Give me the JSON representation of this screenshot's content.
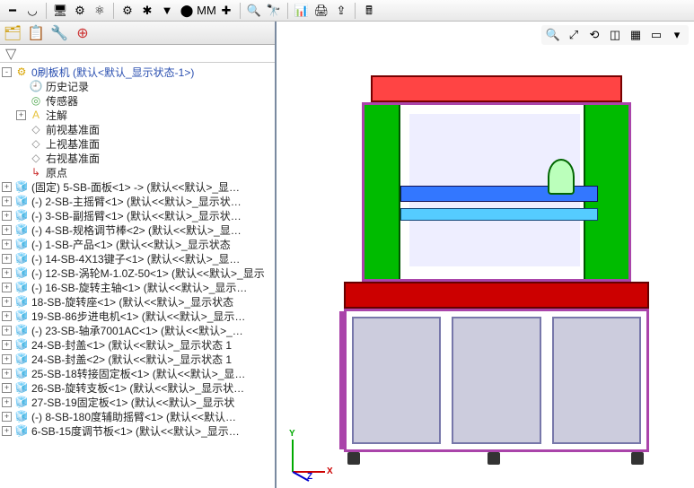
{
  "toolbar": {
    "buttons": [
      {
        "name": "line-icon",
        "glyph": "━",
        "sep": false
      },
      {
        "name": "arc-icon",
        "glyph": "◡",
        "sep": false
      },
      {
        "name": "sep",
        "glyph": "",
        "sep": true
      },
      {
        "name": "display-icon",
        "glyph": "🖥",
        "sep": false
      },
      {
        "name": "gear-icon",
        "glyph": "⚙",
        "sep": false
      },
      {
        "name": "option-icon",
        "glyph": "⚛",
        "sep": false
      },
      {
        "name": "sep",
        "glyph": "",
        "sep": true
      },
      {
        "name": "settings1-icon",
        "glyph": "⚙",
        "sep": false
      },
      {
        "name": "settings2-icon",
        "glyph": "✱",
        "sep": false
      },
      {
        "name": "toggle-icon",
        "glyph": "▼",
        "sep": false
      },
      {
        "name": "record-icon",
        "glyph": "⬤",
        "sep": false
      },
      {
        "name": "measure-icon",
        "glyph": "MM",
        "sep": false
      },
      {
        "name": "plus-icon",
        "glyph": "✚",
        "sep": false
      },
      {
        "name": "sep",
        "glyph": "",
        "sep": true
      },
      {
        "name": "search-icon",
        "glyph": "🔍",
        "sep": false
      },
      {
        "name": "binoculars-icon",
        "glyph": "🔭",
        "sep": false
      },
      {
        "name": "sep",
        "glyph": "",
        "sep": true
      },
      {
        "name": "excel-icon",
        "glyph": "📊",
        "sep": false
      },
      {
        "name": "print-icon",
        "glyph": "🖨",
        "sep": false
      },
      {
        "name": "export-icon",
        "glyph": "⇪",
        "sep": false
      },
      {
        "name": "sep",
        "glyph": "",
        "sep": true
      },
      {
        "name": "calc-icon",
        "glyph": "🖩",
        "sep": false
      }
    ]
  },
  "treeTabs": [
    {
      "name": "feature-manager-tab",
      "glyph": "🗂",
      "color": "#c90"
    },
    {
      "name": "property-manager-tab",
      "glyph": "📋",
      "color": "#7a4"
    },
    {
      "name": "config-manager-tab",
      "glyph": "🔧",
      "color": "#888"
    },
    {
      "name": "dimxpert-tab",
      "glyph": "⊕",
      "color": "#c33"
    }
  ],
  "filterGlyph": "▽",
  "tree": {
    "root": {
      "icon": "⚙",
      "iconCls": "ico-asm",
      "expandable": true,
      "exp": "-",
      "label": "0刷板机  (默认<默认_显示状态-1>)"
    },
    "children": [
      {
        "icon": "🕘",
        "iconCls": "ico-hist",
        "expandable": false,
        "label": "历史记录",
        "depth": 1
      },
      {
        "icon": "◎",
        "iconCls": "ico-sensor",
        "expandable": false,
        "label": "传感器",
        "depth": 1
      },
      {
        "icon": "A",
        "iconCls": "ico-note",
        "expandable": true,
        "exp": "+",
        "label": "注解",
        "depth": 1
      },
      {
        "icon": "◇",
        "iconCls": "ico-plane",
        "expandable": false,
        "label": "前视基准面",
        "depth": 1
      },
      {
        "icon": "◇",
        "iconCls": "ico-plane",
        "expandable": false,
        "label": "上视基准面",
        "depth": 1
      },
      {
        "icon": "◇",
        "iconCls": "ico-plane",
        "expandable": false,
        "label": "右视基准面",
        "depth": 1
      },
      {
        "icon": "↳",
        "iconCls": "ico-origin",
        "expandable": false,
        "label": "原点",
        "depth": 1
      },
      {
        "icon": "🧊",
        "iconCls": "ico-part",
        "expandable": true,
        "exp": "+",
        "label": "(固定) 5-SB-面板<1> -> (默认<<默认>_显…",
        "depth": 0
      },
      {
        "icon": "🧊",
        "iconCls": "ico-part",
        "expandable": true,
        "exp": "+",
        "label": "(-) 2-SB-主摇臂<1> (默认<<默认>_显示状…",
        "depth": 0
      },
      {
        "icon": "🧊",
        "iconCls": "ico-part",
        "expandable": true,
        "exp": "+",
        "label": "(-) 3-SB-副摇臂<1> (默认<<默认>_显示状…",
        "depth": 0
      },
      {
        "icon": "🧊",
        "iconCls": "ico-part",
        "expandable": true,
        "exp": "+",
        "label": "(-) 4-SB-规格调节棒<2> (默认<<默认>_显…",
        "depth": 0
      },
      {
        "icon": "🧊",
        "iconCls": "ico-part",
        "expandable": true,
        "exp": "+",
        "label": "(-) 1-SB-产品<1> (默认<<默认>_显示状态",
        "depth": 0
      },
      {
        "icon": "🧊",
        "iconCls": "ico-part",
        "expandable": true,
        "exp": "+",
        "label": "(-) 14-SB-4X13键子<1> (默认<<默认>_显…",
        "depth": 0
      },
      {
        "icon": "🧊",
        "iconCls": "ico-part",
        "expandable": true,
        "exp": "+",
        "label": "(-) 12-SB-涡轮M-1.0Z-50<1> (默认<<默认>_显示",
        "depth": 0
      },
      {
        "icon": "🧊",
        "iconCls": "ico-part",
        "expandable": true,
        "exp": "+",
        "label": "(-) 16-SB-旋转主轴<1> (默认<<默认>_显示…",
        "depth": 0
      },
      {
        "icon": "🧊",
        "iconCls": "ico-part",
        "expandable": true,
        "exp": "+",
        "label": "18-SB-旋转座<1> (默认<<默认>_显示状态",
        "depth": 0
      },
      {
        "icon": "🧊",
        "iconCls": "ico-part",
        "expandable": true,
        "exp": "+",
        "label": "19-SB-86步进电机<1> (默认<<默认>_显示…",
        "depth": 0
      },
      {
        "icon": "🧊",
        "iconCls": "ico-part",
        "expandable": true,
        "exp": "+",
        "label": "(-) 23-SB-轴承7001AC<1> (默认<<默认>_…",
        "depth": 0
      },
      {
        "icon": "🧊",
        "iconCls": "ico-part",
        "expandable": true,
        "exp": "+",
        "label": "24-SB-封盖<1> (默认<<默认>_显示状态 1",
        "depth": 0
      },
      {
        "icon": "🧊",
        "iconCls": "ico-part",
        "expandable": true,
        "exp": "+",
        "label": "24-SB-封盖<2> (默认<<默认>_显示状态 1",
        "depth": 0
      },
      {
        "icon": "🧊",
        "iconCls": "ico-part",
        "expandable": true,
        "exp": "+",
        "label": "25-SB-18转接固定板<1> (默认<<默认>_显…",
        "depth": 0
      },
      {
        "icon": "🧊",
        "iconCls": "ico-part",
        "expandable": true,
        "exp": "+",
        "label": "26-SB-旋转支板<1> (默认<<默认>_显示状…",
        "depth": 0
      },
      {
        "icon": "🧊",
        "iconCls": "ico-part",
        "expandable": true,
        "exp": "+",
        "label": "27-SB-19固定板<1> (默认<<默认>_显示状",
        "depth": 0
      },
      {
        "icon": "🧊",
        "iconCls": "ico-part",
        "expandable": true,
        "exp": "+",
        "label": "(-) 8-SB-180度辅助摇臂<1> (默认<<默认…",
        "depth": 0
      },
      {
        "icon": "🧊",
        "iconCls": "ico-part",
        "expandable": true,
        "exp": "+",
        "label": "6-SB-15度调节板<1> (默认<<默认>_显示…",
        "depth": 0
      }
    ]
  },
  "viewToolbar": [
    {
      "name": "zoom-fit-icon",
      "glyph": "🔍"
    },
    {
      "name": "zoom-area-icon",
      "glyph": "⤢"
    },
    {
      "name": "rotate-icon",
      "glyph": "⟲"
    },
    {
      "name": "section-icon",
      "glyph": "◫"
    },
    {
      "name": "display-style-icon",
      "glyph": "▦"
    },
    {
      "name": "perspective-icon",
      "glyph": "▭"
    },
    {
      "name": "scene-icon",
      "glyph": "▾"
    }
  ],
  "triad": {
    "x": "X",
    "y": "Y",
    "z": "Z"
  }
}
